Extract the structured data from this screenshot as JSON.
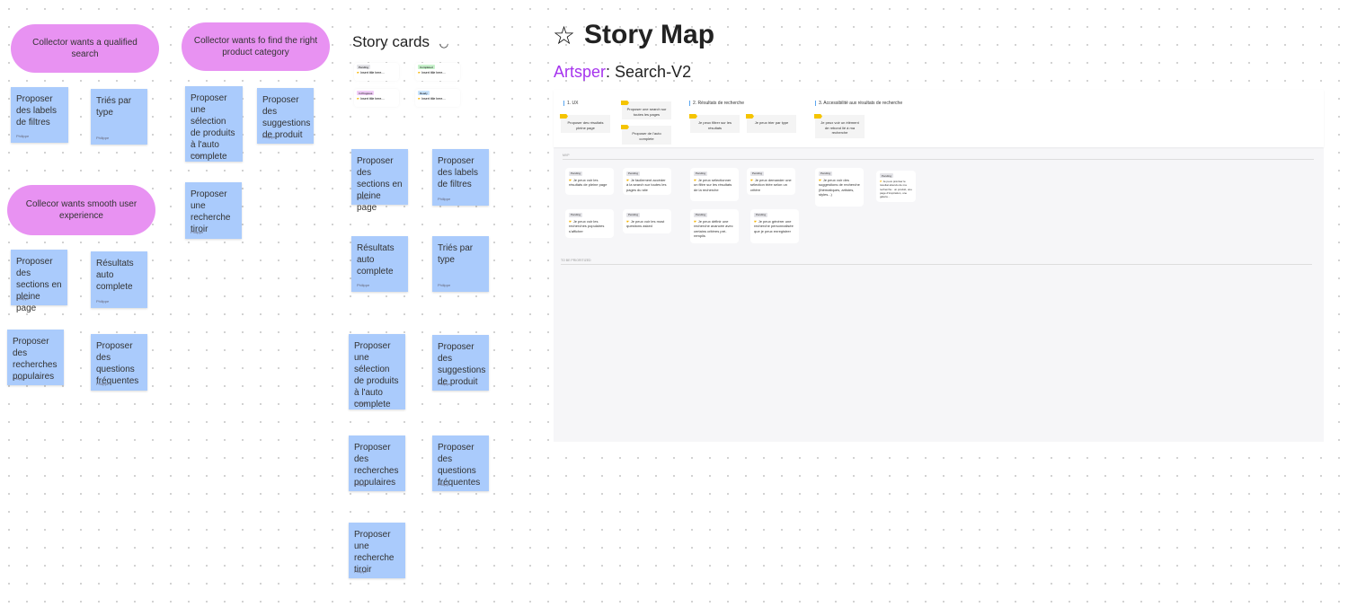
{
  "author": "Philippe",
  "pills": [
    "Collector wants a qualified search",
    "Collector wants fo find the right product category",
    "Collecor wants smooth user experience"
  ],
  "left_stickies": [
    "Proposer des labels de filtres",
    "Triés par type",
    "Proposer une sélection de produits à l'auto complete",
    "Proposer des suggestions de produit",
    "Proposer une recherche tiroir",
    "Proposer des sections en pleine page",
    "Résultats auto complete",
    "Proposer des recherches populaires",
    "Proposer des questions fréquentes"
  ],
  "story_cards": {
    "title": "Story cards",
    "cards": [
      {
        "status": "Pending",
        "title": "Insert title here....",
        "color": "#e4e4e8"
      },
      {
        "status": "Completed",
        "title": "Insert title here....",
        "color": "#c8f2cc"
      },
      {
        "status": "In Progress",
        "title": "Insert title here....",
        "color": "#f0cdf7"
      },
      {
        "status": "Ready",
        "title": "Insert title here....",
        "color": "#c9e3fb"
      }
    ],
    "stickies": [
      "Proposer des sections en pleine page",
      "Proposer des labels de filtres",
      "Résultats auto complete",
      "Triés par type",
      "Proposer une sélection de produits à l'auto complete",
      "Proposer des suggestions de produit",
      "Proposer des recherches populaires",
      "Proposer des questions fréquentes",
      "Proposer une recherche tiroir"
    ]
  },
  "story_map": {
    "title": "Story Map",
    "brand": "Artsper",
    "project": ": Search-V2",
    "activities": [
      "1. UX",
      "2. Résultats de recherche",
      "3. Accessibilité aux résultats de recherche"
    ],
    "goals": [
      "Proposer des résultats pleine page",
      "Proposer une search sur toutes les pages",
      "Proposer de l'auto complete",
      "Je peux filtrer sur les résultats",
      "Je peux trier par type",
      "Je peux voir un élément de rebond lié à ma recherche"
    ],
    "releases": [
      "MVP",
      "TO BE PRIORITIZED"
    ],
    "stories": [
      {
        "status": "Pending",
        "text": "Je peux voir les résultats de pleine page"
      },
      {
        "status": "Pending",
        "text": "Je facilement accéder à la search sur toutes les pages du site"
      },
      {
        "status": "Pending",
        "text": "Je peux sélectionner un filtre sur les résultats de la recherche"
      },
      {
        "status": "Pending",
        "text": "Je peux demander une sélection triée selon un critère"
      },
      {
        "status": "Pending",
        "text": "Je peux voir des suggestions de recherche (thématiques, artistes, styles...)"
      },
      {
        "status": "Pending",
        "text": "Je peux préciser le résultat attendu de ma recherche : un produit, une page d'inspiration, une galerie..."
      },
      {
        "status": "Pending",
        "text": "Je peux voir les recherches populaires s'afficher"
      },
      {
        "status": "Pending",
        "text": "Je peux voir les most questions asked"
      },
      {
        "status": "Pending",
        "text": "Je peux définir une recherche avancée avec certains critères pré-remplis"
      },
      {
        "status": "Pending",
        "text": "Je peux générer une recherche personnalisée que je peux enregistrer"
      }
    ]
  }
}
